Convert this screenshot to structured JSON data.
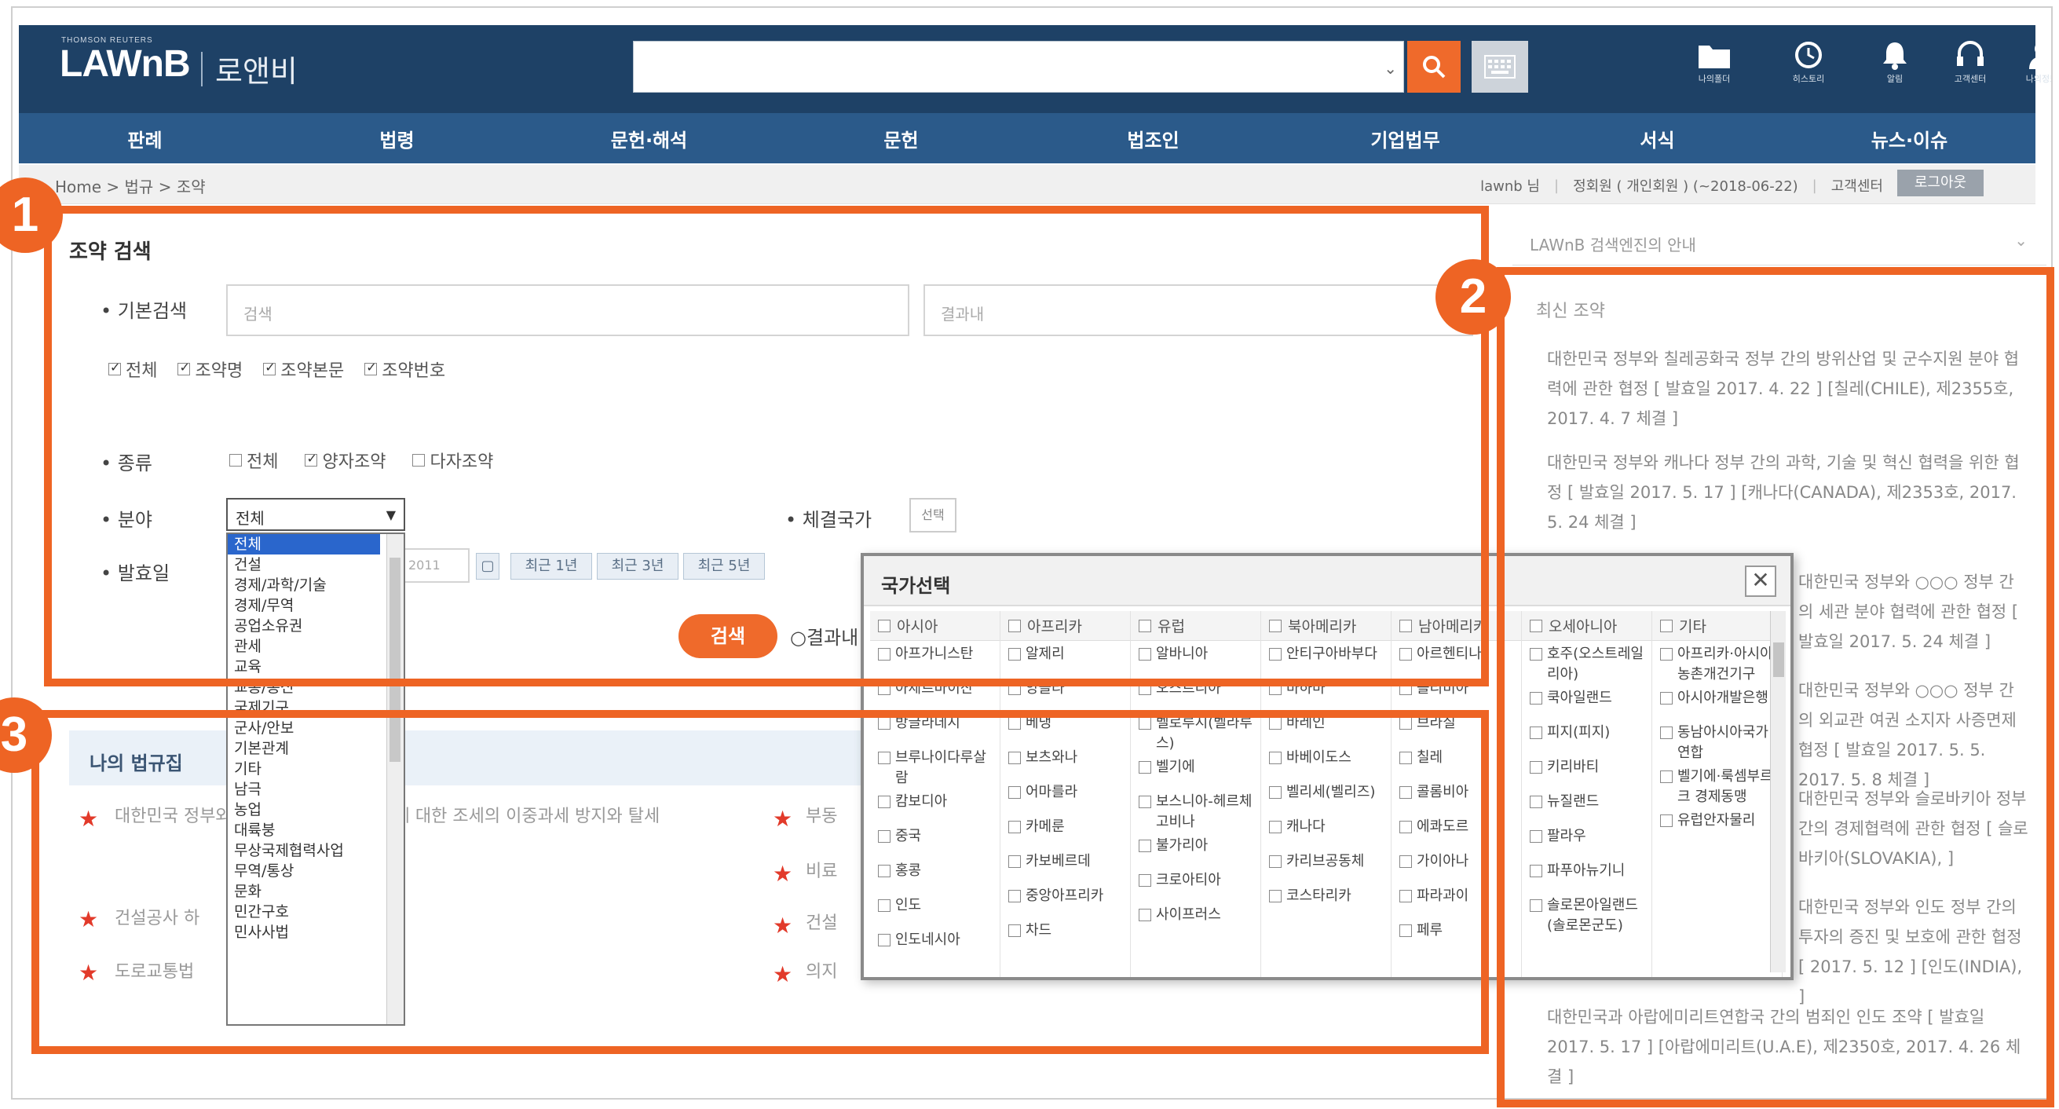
{
  "header": {
    "logo_small": "THOMSON REUTERS",
    "logo": "LAWnB",
    "logo_kr": "로앤비",
    "icons": [
      {
        "name": "folder-icon",
        "label": "나의폴더"
      },
      {
        "name": "history-icon",
        "label": "히스토리"
      },
      {
        "name": "bell-icon",
        "label": "알림"
      },
      {
        "name": "headset-icon",
        "label": "고객센터"
      },
      {
        "name": "user-icon",
        "label": "나의정보"
      }
    ]
  },
  "nav": [
    "판례",
    "법령",
    "문헌·해석",
    "문헌",
    "법조인",
    "기업법무",
    "서식",
    "뉴스·이슈"
  ],
  "breadcrumb": "Home > 법규 > 조약",
  "util": {
    "user": "lawnb 님",
    "member": "정회원 ( 개인회원 ) (~2018-06-22)",
    "center": "고객센터",
    "logout": "로그아웃"
  },
  "search_panel": {
    "title": "조약 검색",
    "basic_label": "• 기본검색",
    "basic_placeholder": "검색",
    "result_placeholder": "결과내",
    "scope_options": [
      {
        "label": "전체",
        "checked": true
      },
      {
        "label": "조약명",
        "checked": true
      },
      {
        "label": "조약본문",
        "checked": true
      },
      {
        "label": "조약번호",
        "checked": true
      }
    ],
    "type_label": "• 종류",
    "type_options": [
      {
        "label": "전체",
        "checked": false
      },
      {
        "label": "양자조약",
        "checked": true
      },
      {
        "label": "다자조약",
        "checked": false
      }
    ],
    "field_label": "• 분야",
    "field_value": "전체",
    "field_options": [
      "전체",
      "건설",
      "경제/과학/기술",
      "경제/무역",
      "공업소유권",
      "관세",
      "교육",
      "교통/통신",
      "국제기구",
      "군사/안보",
      "기본관계",
      "기타",
      "남극",
      "농업",
      "대륙붕",
      "무상국제협력사업",
      "무역/통상",
      "문화",
      "민간구호",
      "민사사법"
    ],
    "date_label": "• 발효일",
    "date_value": "2011",
    "date_buttons": [
      "최근 1년",
      "최근 3년",
      "최근 5년"
    ],
    "country_label": "• 체결국가",
    "country_button": "선택",
    "search_button": "검색",
    "in_result": "결과내 재검색"
  },
  "section3": {
    "title": "나의 법규집",
    "items": [
      {
        "text": "대한민국 정부와 ○○○ 정부 간의 소득에 대한 조세의 이중과세 방지와 탈세"
      },
      {
        "text": "건설공사 하"
      },
      {
        "text": "도로교통법"
      }
    ],
    "items_right": [
      {
        "text": "부동"
      },
      {
        "text": "비료"
      },
      {
        "text": "건설"
      },
      {
        "text": "의지"
      }
    ]
  },
  "right_panel": {
    "info_text": "LAWnB 검색엔진의 안내",
    "info_toggle": "⌄",
    "recent_title": "최신 조약",
    "items": [
      "대한민국 정부와 칠레공화국 정부 간의 방위산업 및 군수지원 분야 협력에 관한 협정 [ 발효일 2017. 4. 22 ] [칠레(CHILE), 제2355호, 2017. 4. 7 체결 ]",
      "대한민국 정부와 캐나다 정부 간의 과학, 기술 및 혁신 협력을 위한 협정 [ 발효일 2017. 5. 17 ] [캐나다(CANADA), 제2353호, 2017. 5. 24 체결 ]",
      "대한민국 정부와 ○○○ 정부 간의 세관 분야 협력에 관한 협정 [ 발효일 2017. 5. 24 체결 ]",
      "대한민국 정부와 ○○○ 정부 간의 외교관 여권 소지자 사증면제 협정 [ 발효일 2017. 5. 5. 2017. 5. 8 체결 ]",
      "대한민국 정부와 슬로바키아 정부 간의 경제협력에 관한 협정 [ 슬로바키아(SLOVAKIA), ]",
      "대한민국 정부와 인도 정부 간의 투자의 증진 및 보호에 관한 협정 [ 2017. 5. 12 ] [인도(INDIA), ]",
      "대한민국과 아랍에미리트연합국 간의 범죄인 인도 조약 [ 발효일 2017. 5. 17 ] [아랍에미리트(U.A.E), 제2350호, 2017. 4. 26 체결 ]"
    ]
  },
  "country_modal": {
    "title": "국가선택",
    "close": "✕",
    "columns": [
      {
        "head": "아시아",
        "items": [
          "아프가니스탄",
          "아제르바이잔",
          "방글라데시",
          "브루나이다루살람",
          "캄보디아",
          "중국",
          "홍콩",
          "인도",
          "인도네시아"
        ]
      },
      {
        "head": "아프리카",
        "items": [
          "알제리",
          "앙골라",
          "베냉",
          "보츠와나",
          "어마를라",
          "카메룬",
          "카보베르데",
          "중앙아프리카",
          "차드"
        ]
      },
      {
        "head": "유럽",
        "items": [
          "알바니아",
          "오스트리아",
          "벨로루시(벨라루스)",
          "벨기에",
          "보스니아-헤르체고비나",
          "불가리아",
          "크로아티아",
          "사이프러스"
        ]
      },
      {
        "head": "북아메리카",
        "items": [
          "안티구아바부다",
          "바하마",
          "바레인",
          "바베이도스",
          "벨리세(벨리즈)",
          "캐나다",
          "카리브공동체",
          "코스타리카"
        ]
      },
      {
        "head": "남아메리카",
        "items": [
          "아르헨티나",
          "볼리비아",
          "브라질",
          "칠레",
          "콜롬비아",
          "에콰도르",
          "가이아나",
          "파라과이",
          "페루"
        ]
      },
      {
        "head": "오세아니아",
        "items": [
          "호주(오스트레일리아)",
          "쿡아일랜드",
          "피지(피지)",
          "키리바티",
          "뉴질랜드",
          "팔라우",
          "파푸아뉴기니",
          "솔로몬아일랜드(솔로몬군도)"
        ]
      },
      {
        "head": "기타",
        "items": [
          "아프리카·아시아 농촌개건기구",
          "아시아개발은행",
          "동남아시아국가연합",
          "벨기에·룩셈부르크 경제동맹",
          "유럽안자물리"
        ]
      }
    ]
  },
  "annotations": [
    "1",
    "2",
    "3"
  ],
  "colors": {
    "accent": "#ee6424",
    "header": "#1e4166",
    "nav": "#2b5a8a"
  }
}
